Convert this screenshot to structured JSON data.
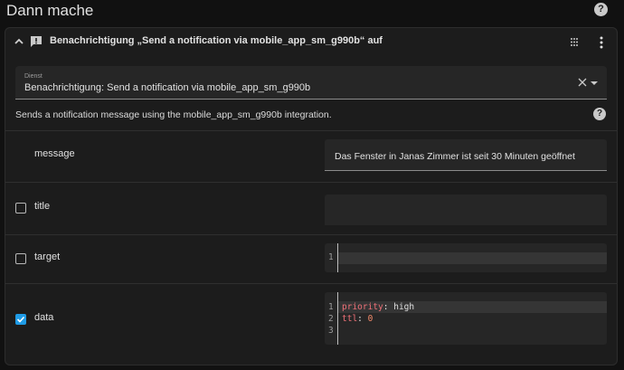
{
  "header": {
    "title": "Dann mache",
    "help_glyph": "?"
  },
  "action": {
    "title": "Benachrichtigung „Send a notification via mobile_app_sm_g990b“ auf",
    "service_label": "Dienst",
    "service_value": "Benachrichtigung: Send a notification via mobile_app_sm_g990b",
    "description": "Sends a notification message using the mobile_app_sm_g990b integration.",
    "help_glyph": "?"
  },
  "fields": {
    "message": {
      "label": "message",
      "value": "Das Fenster in Janas Zimmer ist seit 30 Minuten geöffnet"
    },
    "title": {
      "label": "title",
      "checked": false
    },
    "target": {
      "label": "target",
      "checked": false,
      "line_numbers": [
        "1"
      ]
    },
    "data": {
      "label": "data",
      "checked": true,
      "line_numbers": [
        "1",
        "2",
        "3"
      ],
      "code": {
        "l1_key": "priority",
        "l1_sep": ": ",
        "l1_val": "high",
        "l2_key": "ttl",
        "l2_sep": ": ",
        "l2_val": "0"
      }
    }
  },
  "colors": {
    "accent": "#1f9be6",
    "background": "#111111",
    "card": "#1c1c1c"
  },
  "icons": [
    "chevron-up-icon",
    "alert-message-icon",
    "drag-handle-icon",
    "more-vertical-icon",
    "close-icon",
    "caret-down-icon",
    "help-icon",
    "check-icon"
  ]
}
